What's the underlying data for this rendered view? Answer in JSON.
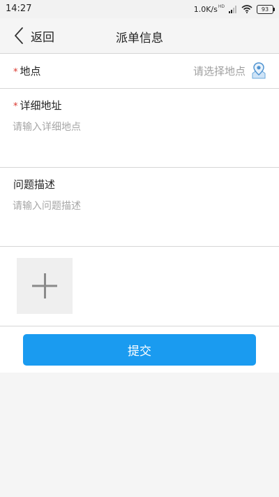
{
  "status_bar": {
    "time": "14:27",
    "network_speed": "1.0K/s",
    "network_tag": "HD",
    "battery": "93"
  },
  "header": {
    "back_label": "返回",
    "title": "派单信息"
  },
  "form": {
    "required_mark": "*",
    "location": {
      "label": "地点",
      "placeholder": "请选择地点"
    },
    "address": {
      "label": "详细地址",
      "placeholder": "请输入详细地点",
      "value": ""
    },
    "problem": {
      "label": "问题描述",
      "placeholder": "请输入问题描述",
      "value": ""
    }
  },
  "submit": {
    "label": "提交"
  },
  "colors": {
    "accent": "#1a9bf0",
    "required": "#d9342b",
    "placeholder": "#a0a0a0"
  },
  "icons": {
    "back": "chevron-left-icon",
    "location": "map-pin-icon",
    "add_photo": "plus-icon",
    "wifi": "wifi-icon",
    "signal": "signal-icon",
    "battery": "battery-icon"
  }
}
